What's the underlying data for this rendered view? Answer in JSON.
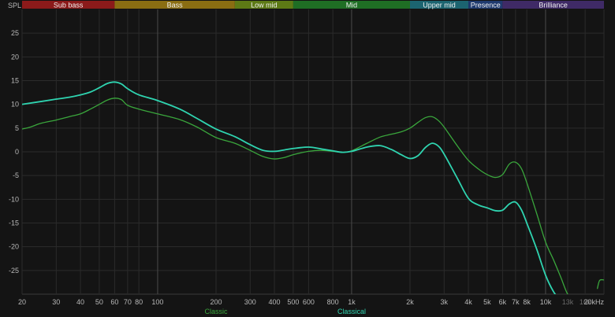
{
  "chart_data": {
    "type": "line",
    "ylabel": "SPL",
    "x_scale": "log",
    "xlim": [
      20,
      20000
    ],
    "ylim": [
      -30,
      30
    ],
    "grid": true,
    "y_ticks": [
      25,
      20,
      15,
      10,
      5,
      0,
      -5,
      -10,
      -15,
      -20,
      -25
    ],
    "x_ticks": [
      {
        "value": 20,
        "label": "20"
      },
      {
        "value": 30,
        "label": "30"
      },
      {
        "value": 40,
        "label": "40"
      },
      {
        "value": 50,
        "label": "50"
      },
      {
        "value": 60,
        "label": "60"
      },
      {
        "value": 70,
        "label": "70"
      },
      {
        "value": 80,
        "label": "80"
      },
      {
        "value": 100,
        "label": "100"
      },
      {
        "value": 200,
        "label": "200"
      },
      {
        "value": 300,
        "label": "300"
      },
      {
        "value": 400,
        "label": "400"
      },
      {
        "value": 500,
        "label": "500"
      },
      {
        "value": 600,
        "label": "600"
      },
      {
        "value": 800,
        "label": "800"
      },
      {
        "value": 1000,
        "label": "1k"
      },
      {
        "value": 2000,
        "label": "2k"
      },
      {
        "value": 3000,
        "label": "3k"
      },
      {
        "value": 4000,
        "label": "4k"
      },
      {
        "value": 5000,
        "label": "5k"
      },
      {
        "value": 6000,
        "label": "6k"
      },
      {
        "value": 7000,
        "label": "7k"
      },
      {
        "value": 8000,
        "label": "8k"
      },
      {
        "value": 10000,
        "label": "10k"
      },
      {
        "value": 13000,
        "label": "13k",
        "dim": true
      },
      {
        "value": 16000,
        "label": "16k",
        "dim": true
      },
      {
        "value": 20000,
        "label": "20kHz"
      }
    ],
    "bands": [
      {
        "name": "Sub bass",
        "from": 20,
        "to": 60,
        "color": "#8b1a1a"
      },
      {
        "name": "Bass",
        "from": 60,
        "to": 250,
        "color": "#8a6d12"
      },
      {
        "name": "Low mid",
        "from": 250,
        "to": 500,
        "color": "#5d7a15"
      },
      {
        "name": "Mid",
        "from": 500,
        "to": 2000,
        "color": "#1f6e24"
      },
      {
        "name": "Upper mid",
        "from": 2000,
        "to": 4000,
        "color": "#1c6470"
      },
      {
        "name": "Presence",
        "from": 4000,
        "to": 6000,
        "color": "#1f3a6e"
      },
      {
        "name": "Brilliance",
        "from": 6000,
        "to": 20000,
        "color": "#3f2a66"
      }
    ],
    "series": [
      {
        "name": "Classic",
        "color": "#3aa63c",
        "x": [
          20,
          22,
          25,
          30,
          35,
          40,
          45,
          50,
          55,
          60,
          65,
          70,
          80,
          100,
          130,
          160,
          200,
          250,
          300,
          350,
          400,
          450,
          500,
          600,
          700,
          800,
          900,
          1000,
          1200,
          1400,
          1600,
          1800,
          2000,
          2200,
          2400,
          2600,
          2800,
          3000,
          3500,
          4000,
          4500,
          5000,
          5500,
          6000,
          6500,
          7000,
          7500,
          8000,
          9000,
          10000,
          11000,
          12000,
          13000,
          14000
        ],
        "y": [
          4.8,
          5.2,
          6.0,
          6.7,
          7.4,
          8.0,
          9.0,
          10.0,
          10.9,
          11.3,
          11.0,
          9.8,
          9.0,
          8.0,
          6.8,
          5.2,
          3.0,
          1.8,
          0.3,
          -1.0,
          -1.5,
          -1.2,
          -0.6,
          0.1,
          0.3,
          0.1,
          -0.1,
          0.2,
          1.8,
          3.1,
          3.7,
          4.2,
          5.0,
          6.2,
          7.2,
          7.4,
          6.6,
          5.2,
          1.3,
          -1.8,
          -3.6,
          -4.8,
          -5.4,
          -4.8,
          -2.6,
          -2.2,
          -3.5,
          -6.5,
          -13.0,
          -19.0,
          -22.8,
          -26.5,
          -30.0,
          -31.0
        ]
      },
      {
        "name": "Classical",
        "color": "#2fd4b0",
        "x": [
          20,
          25,
          30,
          35,
          40,
          45,
          50,
          55,
          60,
          65,
          70,
          80,
          100,
          130,
          160,
          200,
          250,
          300,
          350,
          400,
          450,
          500,
          600,
          700,
          800,
          900,
          1000,
          1200,
          1400,
          1600,
          1800,
          2000,
          2200,
          2400,
          2600,
          2800,
          3000,
          3500,
          4000,
          4500,
          5000,
          5500,
          6000,
          6500,
          7000,
          7500,
          8000,
          9000,
          10000,
          11000,
          12000
        ],
        "y": [
          10.0,
          10.6,
          11.1,
          11.5,
          12.0,
          12.6,
          13.5,
          14.4,
          14.7,
          14.3,
          13.3,
          12.0,
          10.8,
          9.0,
          7.0,
          4.8,
          3.2,
          1.5,
          0.3,
          0.1,
          0.4,
          0.7,
          1.0,
          0.6,
          0.2,
          -0.1,
          0.1,
          1.0,
          1.3,
          0.5,
          -0.6,
          -1.4,
          -0.8,
          0.9,
          1.8,
          1.2,
          -0.5,
          -5.5,
          -9.8,
          -11.2,
          -11.8,
          -12.4,
          -12.3,
          -11.0,
          -10.6,
          -12.2,
          -15.0,
          -20.5,
          -26.0,
          -29.5,
          -31.5
        ]
      },
      {
        "name": "",
        "color": "#3aa63c",
        "x": [
          18500,
          19000,
          20000
        ],
        "y": [
          -28.8,
          -27.1,
          -27.0
        ]
      }
    ],
    "legend": [
      {
        "label": "Classic",
        "color": "#3aa63c",
        "at": 200
      },
      {
        "label": "Classical",
        "color": "#2fd4b0",
        "at": 1000
      }
    ]
  }
}
